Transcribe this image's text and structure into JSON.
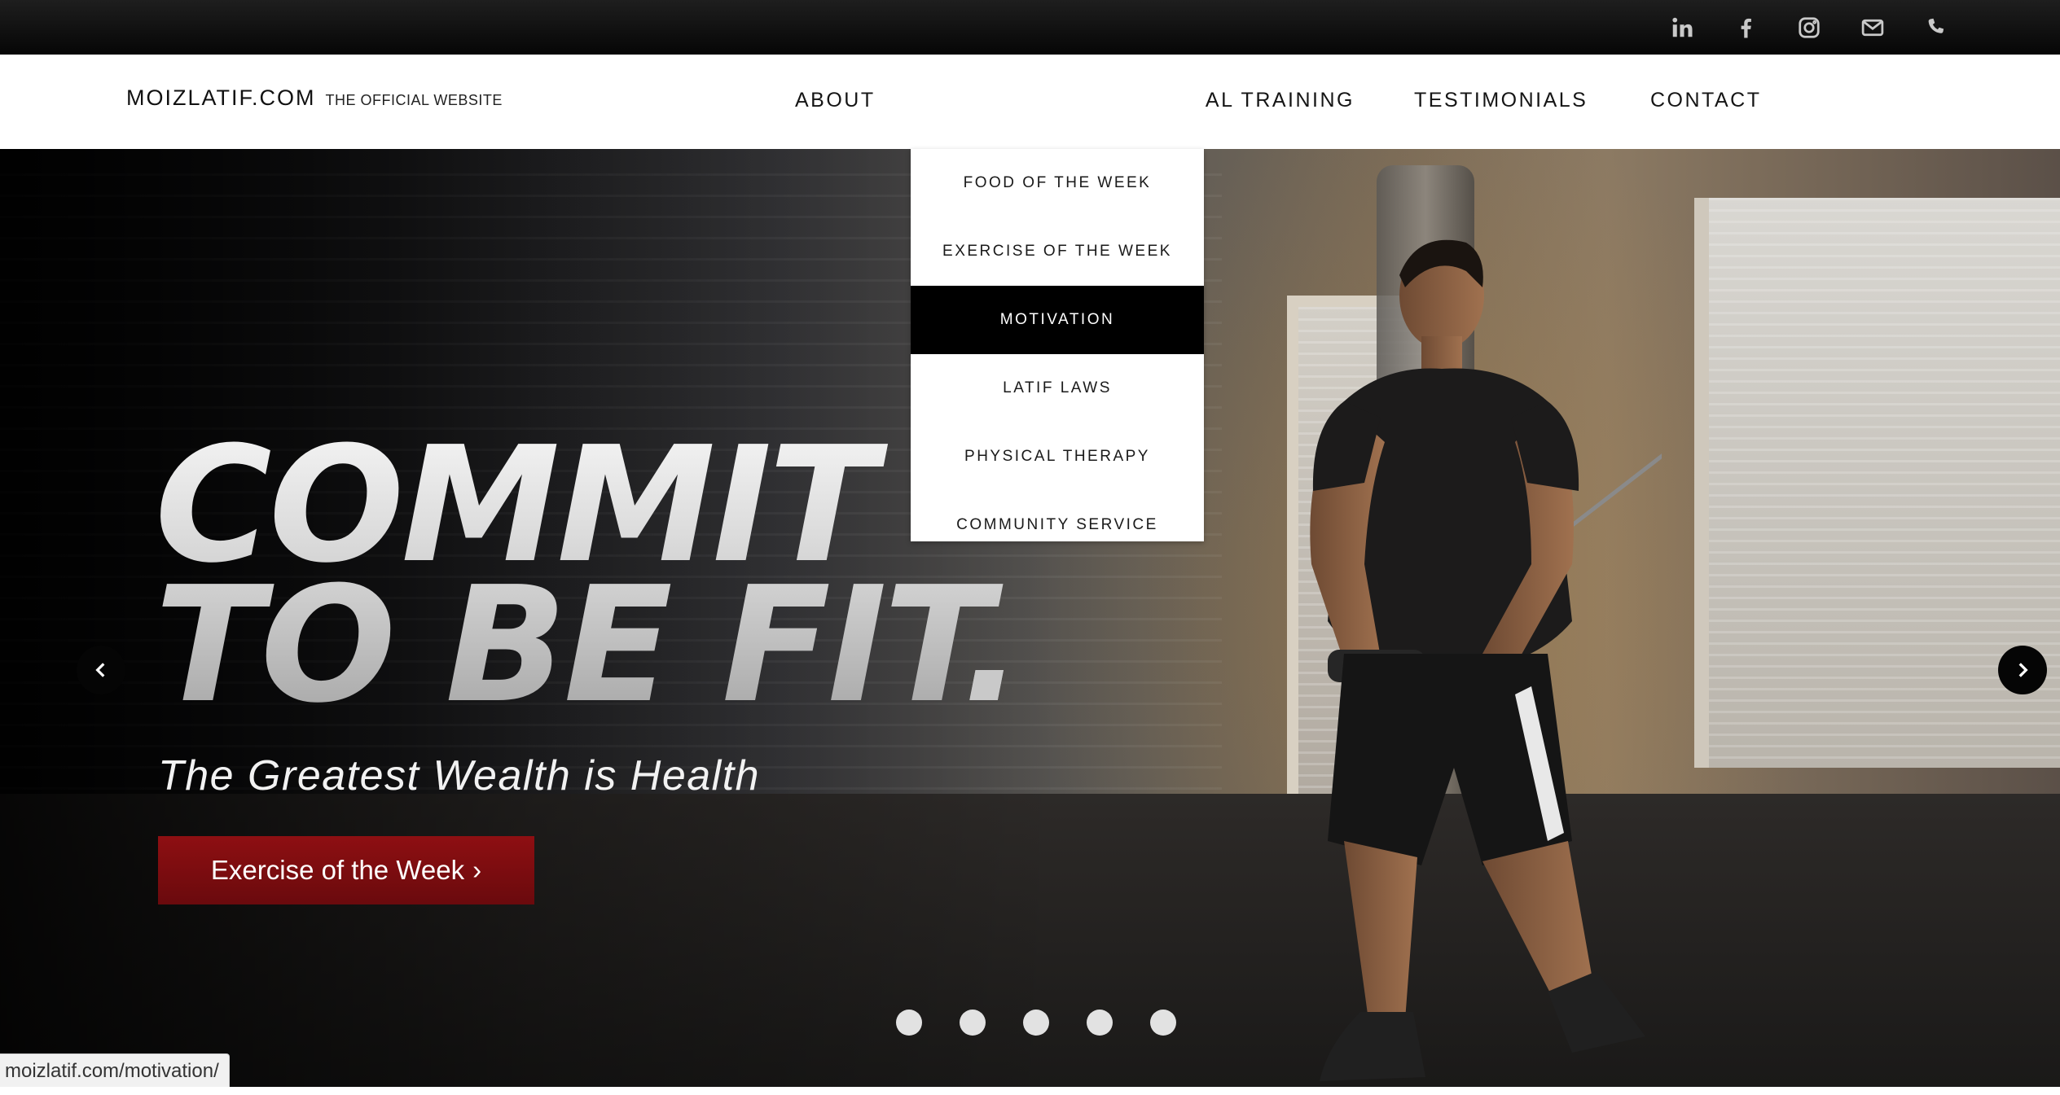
{
  "topbar": {
    "social_icons": [
      "linkedin-icon",
      "facebook-icon",
      "instagram-icon",
      "mail-icon",
      "phone-icon"
    ],
    "icon_color": "#c9c9c9"
  },
  "header": {
    "brand_name": "MOIZLATIF.COM",
    "brand_tagline": "THE OFFICIAL WEBSITE",
    "nav": {
      "about": "ABOUT",
      "training_partial": "AL TRAINING",
      "testimonials": "TESTIMONIALS",
      "contact": "CONTACT"
    }
  },
  "dropdown": {
    "items": [
      "FOOD OF THE WEEK",
      "EXERCISE OF THE WEEK",
      "MOTIVATION",
      "LATIF LAWS",
      "PHYSICAL THERAPY",
      "COMMUNITY SERVICE"
    ],
    "active_item": "MOTIVATION"
  },
  "hero": {
    "headline_line1": "COMMIT",
    "headline_line2": "TO BE FIT",
    "headline_dot": ".",
    "tagline": "The Greatest Wealth is Health",
    "cta_label": "Exercise of the Week",
    "cta_chevron": "›",
    "cta_color": "#8e0f12",
    "slide_count": 5
  },
  "statusbar": {
    "url": "moizlatif.com/motivation/"
  }
}
